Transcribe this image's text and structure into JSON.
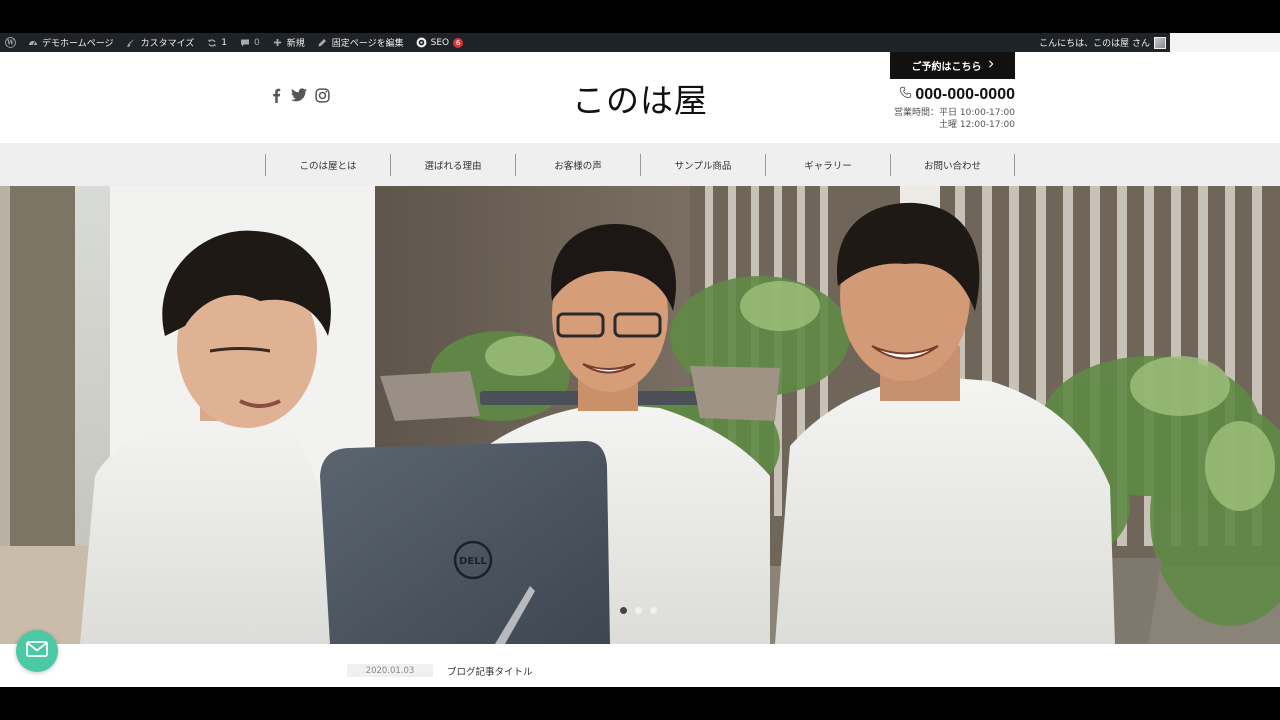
{
  "admin_bar": {
    "site_name": "デモホームページ",
    "customize": "カスタマイズ",
    "updates_count": "1",
    "comments_count": "0",
    "new_label": "新規",
    "edit_page": "固定ページを編集",
    "seo_label": "SEO",
    "seo_badge": "6",
    "greeting": "こんにちは、このは屋 さん"
  },
  "header": {
    "site_title": "このは屋",
    "reserve_label": "ご予約はこちら",
    "phone": "000-000-0000",
    "hours_line1": "営業時間：平日 10:00-17:00",
    "hours_line2": "土曜 12:00-17:00"
  },
  "nav": {
    "items": [
      {
        "label": "このは屋とは"
      },
      {
        "label": "選ばれる理由"
      },
      {
        "label": "お客様の声"
      },
      {
        "label": "サンプル商品"
      },
      {
        "label": "ギャラリー"
      },
      {
        "label": "お問い合わせ"
      }
    ]
  },
  "hero": {
    "laptop_brand": "DELL",
    "slide_count": 3,
    "active_slide": 1
  },
  "post": {
    "date": "2020.01.03",
    "title": "ブログ記事タイトル"
  },
  "colors": {
    "admin_bar": "#1d2327",
    "nav_bg": "#efefef",
    "mail_button": "#4bc9a4",
    "badge": "#d63638"
  }
}
